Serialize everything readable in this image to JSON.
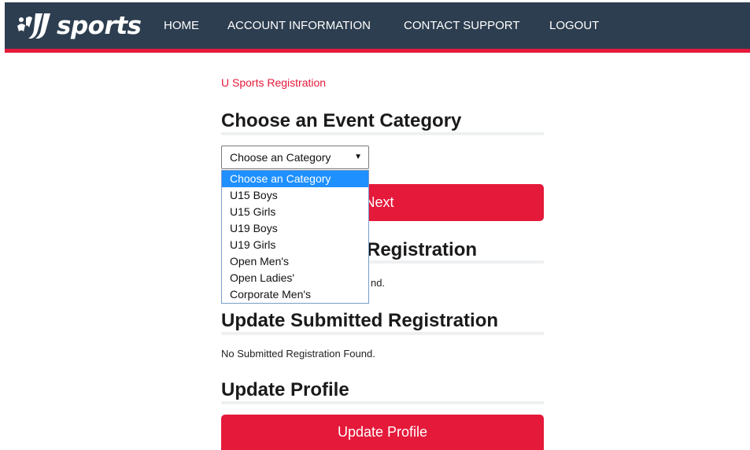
{
  "brand": {
    "name": "sports",
    "accent_color": "#e5193a",
    "nav_color": "#2d3e50"
  },
  "nav": {
    "home": "HOME",
    "account": "ACCOUNT INFORMATION",
    "support": "CONTACT SUPPORT",
    "logout": "LOGOUT"
  },
  "breadcrumb": "U Sports Registration",
  "choose_category": {
    "title": "Choose an Event Category",
    "select_value": "Choose an Category",
    "next_label": "Next",
    "options": [
      "Choose an Category",
      "U15 Boys",
      "U15 Girls",
      "U19 Boys",
      "U19 Girls",
      "Open Men's",
      "Open Ladies'",
      "Corporate Men's"
    ]
  },
  "pending": {
    "title_visible": "Registration",
    "message_visible": "nd."
  },
  "submitted": {
    "title": "Update Submitted Registration",
    "message": "No Submitted Registration Found."
  },
  "profile": {
    "title": "Update Profile",
    "button_label": "Update Profile"
  }
}
